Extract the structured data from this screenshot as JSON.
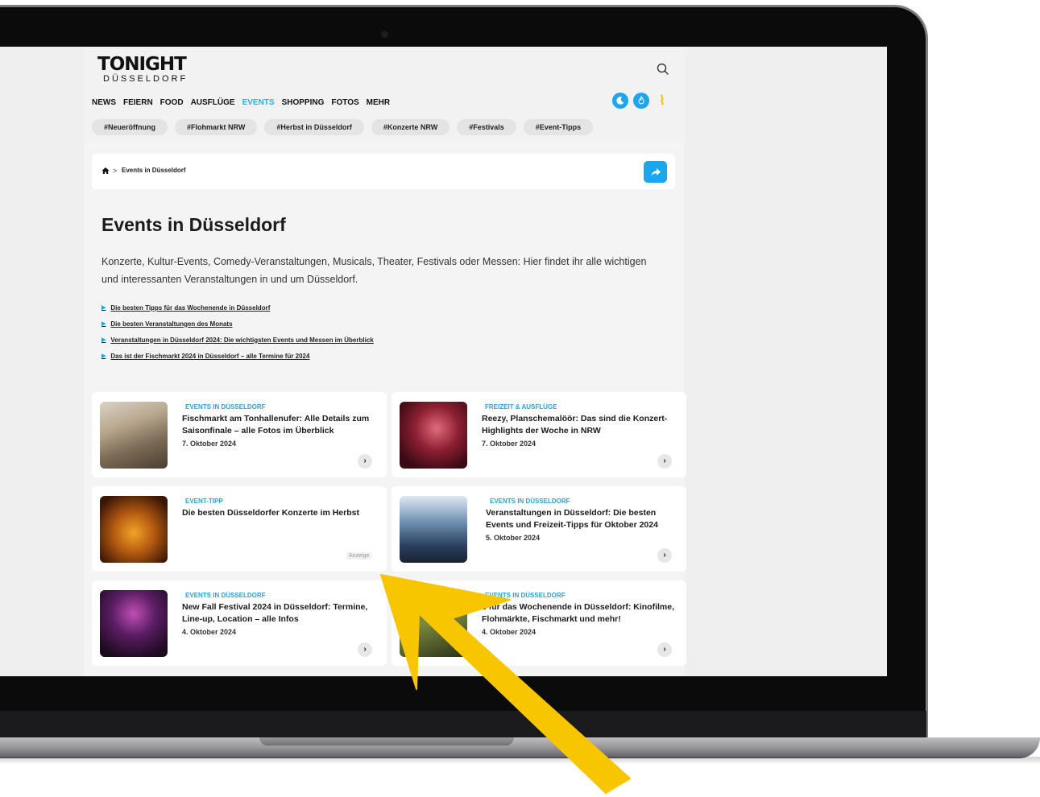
{
  "logo": {
    "main": "TONIGHT",
    "sub": "DÜSSELDORF"
  },
  "nav": [
    "NEWS",
    "FEIERN",
    "FOOD",
    "AUSFLÜGE",
    "EVENTS",
    "SHOPPING",
    "FOTOS",
    "MEHR"
  ],
  "nav_active": "EVENTS",
  "tags": [
    "#Neueröffnung",
    "#Flohmarkt NRW",
    "#Herbst in Düsseldorf",
    "#Konzerte NRW",
    "#Festivals",
    "#Event-Tipps"
  ],
  "breadcrumb": {
    "separator": ">",
    "current": "Events in Düsseldorf"
  },
  "page": {
    "title": "Events in Düsseldorf",
    "intro": "Konzerte, Kultur-Events, Comedy-Veranstaltungen, Musicals, Theater, Festivals oder Messen: Hier findet ihr alle wichtigen und interessanten Veranstaltungen in und um Düsseldorf.",
    "links": [
      "Die besten Tipps für das Wochenende in Düsseldorf",
      "Die besten Veranstaltungen des Monats",
      "Veranstaltungen in Düsseldorf 2024: Die wichtigsten Events und Messen im Überblick",
      "Das ist der Fischmarkt 2024 in Düsseldorf – alle Termine für 2024"
    ]
  },
  "cards": [
    {
      "category": "EVENTS IN DÜSSELDORF",
      "title": "Fischmarkt am Tonhallenufer: Alle Details zum Saisonfinale – alle Fotos im Überblick",
      "date": "7. Oktober 2024",
      "button": "›"
    },
    {
      "category": "FREIZEIT & AUSFLÜGE",
      "title": "Reezy, Planschemalöör: Das sind die Konzert-Highlights der Woche in NRW",
      "date": "7. Oktober 2024",
      "button": "›"
    },
    {
      "category": "EVENT-TIPP",
      "title": "Die besten Düsseldorfer Konzerte im Herbst",
      "ad_label": "Anzeige"
    },
    {
      "category": "EVENTS IN DÜSSELDORF",
      "title": "Veranstaltungen in Düsseldorf: Die besten Events und Freizeit-Tipps für Oktober 2024",
      "date": "5. Oktober 2024",
      "button": "›"
    },
    {
      "category": "EVENTS IN DÜSSELDORF",
      "title": "New Fall Festival 2024 in Düsseldorf: Termine, Line-up, Location – alle Infos",
      "date": "4. Oktober 2024",
      "button": "›"
    },
    {
      "category": "EVENTS IN DÜSSELDORF",
      "title": "s für das Wochenende in Düsseldorf: Kinofilme, Flohmärkte, Fischmarkt und mehr!",
      "date": "4. Oktober 2024",
      "button": "›"
    }
  ],
  "colors": {
    "accent": "#1ea6ec",
    "arrow": "#f7c600",
    "laptop_frame": "#0b0b0b"
  },
  "icons": {
    "search": "search-icon",
    "dark_mode": "moon-icon",
    "fire": "flame-icon",
    "home": "home-icon",
    "share": "share-icon"
  }
}
